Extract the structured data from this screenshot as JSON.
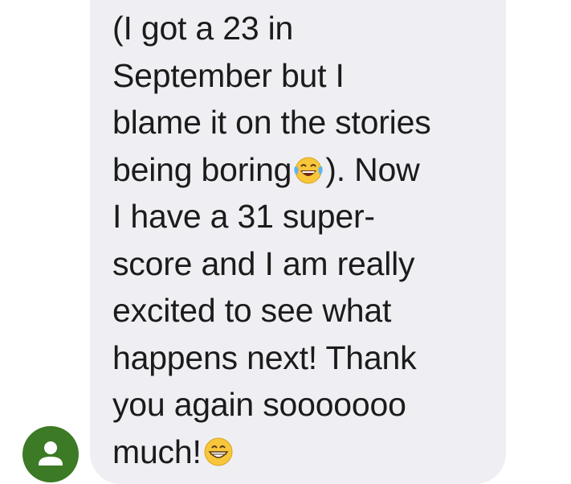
{
  "message": {
    "lines": [
      "(I got a 23 in",
      "September but I",
      "blame it on the stories",
      "being boring",
      "). Now",
      "I have a 31 super-",
      "score and I am really",
      "excited to see what",
      "happens next! Thank",
      "you again sooooooo",
      "much!"
    ],
    "emojis": [
      "face-with-tears-of-joy",
      "grinning-face-with-smiling-eyes"
    ]
  },
  "avatar": {
    "color": "#3c7a25",
    "icon": "person-icon"
  },
  "bubble": {
    "color": "#efeff3"
  }
}
